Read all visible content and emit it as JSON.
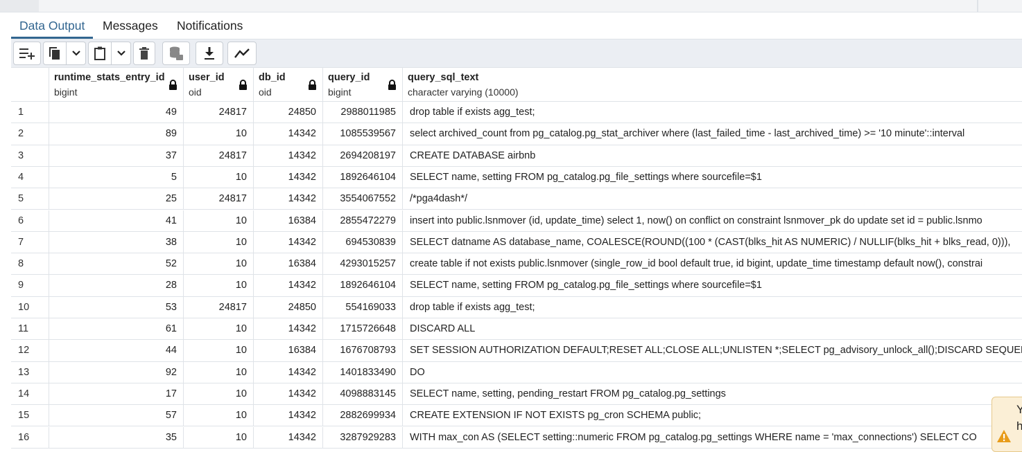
{
  "tabs": [
    {
      "label": "Data Output",
      "active": true
    },
    {
      "label": "Messages",
      "active": false
    },
    {
      "label": "Notifications",
      "active": false
    }
  ],
  "toolbar": {
    "icons": [
      "add-row-icon",
      "copy-icon",
      "chevron-down-icon",
      "paste-icon",
      "chevron-down-icon",
      "delete-icon",
      "save-data-icon",
      "download-icon",
      "graph-icon"
    ]
  },
  "columns": [
    {
      "name": "runtime_stats_entry_id",
      "type": "bigint",
      "locked": true
    },
    {
      "name": "user_id",
      "type": "oid",
      "locked": true
    },
    {
      "name": "db_id",
      "type": "oid",
      "locked": true
    },
    {
      "name": "query_id",
      "type": "bigint",
      "locked": true
    },
    {
      "name": "query_sql_text",
      "type": "character varying (10000)",
      "locked": false
    }
  ],
  "rows": [
    {
      "n": "1",
      "runtime_stats_entry_id": "49",
      "user_id": "24817",
      "db_id": "24850",
      "query_id": "2988011985",
      "query_sql_text": "drop table if exists agg_test;"
    },
    {
      "n": "2",
      "runtime_stats_entry_id": "89",
      "user_id": "10",
      "db_id": "14342",
      "query_id": "1085539567",
      "query_sql_text": "select archived_count from pg_catalog.pg_stat_archiver where (last_failed_time - last_archived_time) >= '10 minute'::interval"
    },
    {
      "n": "3",
      "runtime_stats_entry_id": "37",
      "user_id": "24817",
      "db_id": "14342",
      "query_id": "2694208197",
      "query_sql_text": "CREATE DATABASE airbnb"
    },
    {
      "n": "4",
      "runtime_stats_entry_id": "5",
      "user_id": "10",
      "db_id": "14342",
      "query_id": "1892646104",
      "query_sql_text": "SELECT name, setting FROM pg_catalog.pg_file_settings where sourcefile=$1"
    },
    {
      "n": "5",
      "runtime_stats_entry_id": "25",
      "user_id": "24817",
      "db_id": "14342",
      "query_id": "3554067552",
      "query_sql_text": "/*pga4dash*/"
    },
    {
      "n": "6",
      "runtime_stats_entry_id": "41",
      "user_id": "10",
      "db_id": "16384",
      "query_id": "2855472279",
      "query_sql_text": "insert into public.lsnmover (id, update_time) select 1, now() on conflict on constraint lsnmover_pk do update set id = public.lsnmo"
    },
    {
      "n": "7",
      "runtime_stats_entry_id": "38",
      "user_id": "10",
      "db_id": "14342",
      "query_id": "694530839",
      "query_sql_text": "SELECT datname AS database_name, COALESCE(ROUND((100 * (CAST(blks_hit AS NUMERIC) / NULLIF(blks_hit + blks_read, 0))),"
    },
    {
      "n": "8",
      "runtime_stats_entry_id": "52",
      "user_id": "10",
      "db_id": "16384",
      "query_id": "4293015257",
      "query_sql_text": "create table if not exists public.lsnmover (single_row_id bool default true, id bigint, update_time timestamp default now(), constrai"
    },
    {
      "n": "9",
      "runtime_stats_entry_id": "28",
      "user_id": "10",
      "db_id": "14342",
      "query_id": "1892646104",
      "query_sql_text": "SELECT name, setting FROM pg_catalog.pg_file_settings where sourcefile=$1"
    },
    {
      "n": "10",
      "runtime_stats_entry_id": "53",
      "user_id": "24817",
      "db_id": "24850",
      "query_id": "554169033",
      "query_sql_text": "drop table if exists agg_test;"
    },
    {
      "n": "11",
      "runtime_stats_entry_id": "61",
      "user_id": "10",
      "db_id": "14342",
      "query_id": "1715726648",
      "query_sql_text": "DISCARD ALL"
    },
    {
      "n": "12",
      "runtime_stats_entry_id": "44",
      "user_id": "10",
      "db_id": "16384",
      "query_id": "1676708793",
      "query_sql_text": "SET SESSION AUTHORIZATION DEFAULT;RESET ALL;CLOSE ALL;UNLISTEN *;SELECT pg_advisory_unlock_all();DISCARD SEQUENC"
    },
    {
      "n": "13",
      "runtime_stats_entry_id": "92",
      "user_id": "10",
      "db_id": "14342",
      "query_id": "1401833490",
      "query_sql_text": "DO"
    },
    {
      "n": "14",
      "runtime_stats_entry_id": "17",
      "user_id": "10",
      "db_id": "14342",
      "query_id": "4098883145",
      "query_sql_text": "SELECT name, setting, pending_restart FROM pg_catalog.pg_settings"
    },
    {
      "n": "15",
      "runtime_stats_entry_id": "57",
      "user_id": "10",
      "db_id": "14342",
      "query_id": "2882699934",
      "query_sql_text": "CREATE EXTENSION IF NOT EXISTS pg_cron SCHEMA public;"
    },
    {
      "n": "16",
      "runtime_stats_entry_id": "35",
      "user_id": "10",
      "db_id": "14342",
      "query_id": "3287929283",
      "query_sql_text": "WITH max_con AS (SELECT setting::numeric FROM pg_catalog.pg_settings WHERE name = 'max_connections') SELECT CO"
    }
  ],
  "toast": {
    "line1": "Y",
    "line2": "h",
    "icon": "warning-icon"
  },
  "colors": {
    "accent": "#326690",
    "toolbar_bg": "#ebeef3",
    "border": "#dfe3e8",
    "toast_bg": "#fbefd6",
    "warning": "#e89c1a"
  }
}
